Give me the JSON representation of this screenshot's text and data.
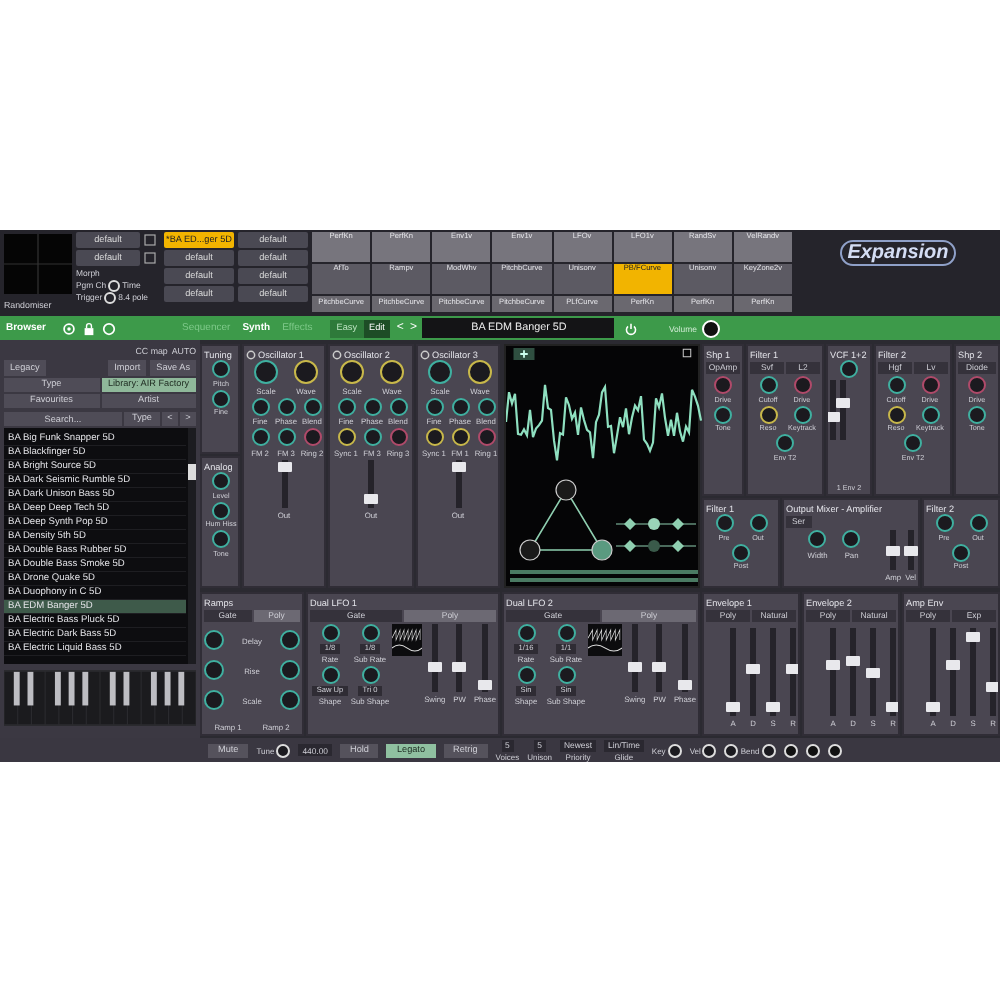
{
  "header": {
    "randomiser": "Randomiser",
    "slot_column": [
      {
        "label": "default"
      },
      {
        "label": "default"
      }
    ],
    "options": [
      {
        "label": "Morph"
      },
      {
        "label": "Pgm Ch",
        "radio": "Time",
        "checked": false
      },
      {
        "label": "Trigger",
        "radio": "8.4 pole",
        "checked": false
      }
    ],
    "patch_slots": [
      {
        "label": "*BA ED...ger 5D",
        "selected": true
      },
      {
        "label": "default",
        "selected": false
      },
      {
        "label": "default",
        "selected": false
      },
      {
        "label": "default",
        "selected": false
      },
      {
        "label": "default",
        "selected": false
      },
      {
        "label": "default",
        "selected": false
      },
      {
        "label": "default",
        "selected": false
      },
      {
        "label": "default",
        "selected": false
      }
    ],
    "mod_matrix": [
      [
        {
          "label": "PerfKn",
          "selected": false
        },
        {
          "label": "PerfKn",
          "selected": false
        },
        {
          "label": "Env1v",
          "selected": false
        },
        {
          "label": "Env1v",
          "selected": false
        },
        {
          "label": "LFOv",
          "selected": false
        },
        {
          "label": "LFO1v",
          "selected": false
        },
        {
          "label": "RandSv",
          "selected": false
        },
        {
          "label": "VelRandv",
          "selected": false
        }
      ],
      [
        {
          "label": "AfTo",
          "selected": false
        },
        {
          "label": "Rampv",
          "selected": false
        },
        {
          "label": "ModWhv",
          "selected": false
        },
        {
          "label": "PitchbCurve",
          "selected": false
        },
        {
          "label": "Unisonv",
          "selected": false
        },
        {
          "label": "PB/FCurve",
          "selected": true
        },
        {
          "label": "Unisonv",
          "selected": false
        },
        {
          "label": "KeyZone2v",
          "selected": false
        }
      ],
      [
        {
          "label": "PitchbeCurve",
          "selected": false
        },
        {
          "label": "PitchbeCurve",
          "selected": false
        },
        {
          "label": "PitchbeCurve",
          "selected": false
        },
        {
          "label": "PitchbeCurve",
          "selected": false
        },
        {
          "label": "PLfCurve",
          "selected": false
        },
        {
          "label": "PerfKn",
          "selected": false
        },
        {
          "label": "PerfKn",
          "selected": false
        },
        {
          "label": "PerfKn",
          "selected": false
        }
      ]
    ],
    "logo": "Expansion"
  },
  "navbar": {
    "title": "Browser",
    "tabs": [
      {
        "label": "Sequencer",
        "selected": false
      },
      {
        "label": "Synth",
        "selected": true
      },
      {
        "label": "Effects",
        "selected": false
      }
    ],
    "modes": [
      {
        "label": "Easy",
        "selected": false
      },
      {
        "label": "Edit",
        "selected": true
      }
    ],
    "prev": "<",
    "next": ">",
    "preset": "BA EDM Banger 5D",
    "volume": "Volume"
  },
  "browser": {
    "cc_map": "CC map",
    "cc_value": "AUTO",
    "legacy": "Legacy",
    "import": "Import",
    "save_as": "Save As",
    "filters": [
      {
        "label": "Type",
        "selected": false
      },
      {
        "label": "Library: AIR Factory",
        "selected": true
      },
      {
        "label": "Favourites",
        "selected": false
      },
      {
        "label": "Artist",
        "selected": false
      }
    ],
    "search": {
      "placeholder": "Search..."
    },
    "sort": "Type",
    "prev": "<",
    "next": ">",
    "presets": [
      {
        "name": "BA Big Funk Snapper 5D",
        "selected": false
      },
      {
        "name": "BA Blackfinger 5D",
        "selected": false
      },
      {
        "name": "BA Bright Source 5D",
        "selected": false
      },
      {
        "name": "BA Dark Seismic Rumble 5D",
        "selected": false
      },
      {
        "name": "BA Dark Unison Bass 5D",
        "selected": false
      },
      {
        "name": "BA Deep Deep Tech 5D",
        "selected": false
      },
      {
        "name": "BA Deep Synth Pop 5D",
        "selected": false
      },
      {
        "name": "BA Density 5th 5D",
        "selected": false
      },
      {
        "name": "BA Double Bass Rubber 5D",
        "selected": false
      },
      {
        "name": "BA Double Bass Smoke 5D",
        "selected": false
      },
      {
        "name": "BA Drone Quake 5D",
        "selected": false
      },
      {
        "name": "BA Duophony in C 5D",
        "selected": false
      },
      {
        "name": "BA EDM Banger 5D",
        "selected": true
      },
      {
        "name": "BA Electric Bass Pluck 5D",
        "selected": false
      },
      {
        "name": "BA Electric Dark Bass 5D",
        "selected": false
      },
      {
        "name": "BA Electric Liquid Bass 5D",
        "selected": false
      }
    ]
  },
  "left_column": [
    {
      "title": "Tuning",
      "kind": "basic",
      "knobs": [
        {
          "label": "Pitch",
          "color": "#3fb0a0"
        },
        {
          "label": "Fine",
          "color": "#3fb0a0"
        }
      ]
    },
    {
      "title": "Analog",
      "kind": "basic",
      "knobs": [
        {
          "label": "Level",
          "color": "#3fb0a0"
        },
        {
          "label": "Hum Hiss",
          "color": "#3fb0a0"
        },
        {
          "label": "Tone",
          "color": "#3fb0a0"
        }
      ]
    }
  ],
  "oscillators": [
    {
      "title": "Oscillator 1",
      "kind": "osc",
      "knobs": [
        {
          "label": "Scale",
          "color": "#3fb0a0"
        },
        {
          "label": "Wave",
          "color": "#c8b84a"
        },
        {
          "label": "Fine",
          "color": "#3fb0a0"
        },
        {
          "label": "Phase",
          "color": "#3fb0a0"
        },
        {
          "label": "Blend",
          "color": "#3fb0a0"
        },
        {
          "label": "FM 2",
          "color": "#3fb0a0"
        },
        {
          "label": "FM 3",
          "color": "#3fb0a0"
        },
        {
          "label": "Ring 2",
          "color": "#b04a6a"
        }
      ],
      "sliders": [
        {
          "label": "Out",
          "level": 0.9
        }
      ]
    },
    {
      "title": "Oscillator 2",
      "kind": "osc",
      "knobs": [
        {
          "label": "Scale",
          "color": "#c8b84a"
        },
        {
          "label": "Wave",
          "color": "#c8b84a"
        },
        {
          "label": "Fine",
          "color": "#3fb0a0"
        },
        {
          "label": "Phase",
          "color": "#3fb0a0"
        },
        {
          "label": "Blend",
          "color": "#3fb0a0"
        },
        {
          "label": "Sync 1",
          "color": "#c8b84a"
        },
        {
          "label": "FM 3",
          "color": "#3fb0a0"
        },
        {
          "label": "Ring 3",
          "color": "#b04a6a"
        }
      ],
      "sliders": [
        {
          "label": "Out",
          "level": 0.1
        }
      ]
    },
    {
      "title": "Oscillator 3",
      "kind": "osc",
      "knobs": [
        {
          "label": "Scale",
          "color": "#3fb0a0"
        },
        {
          "label": "Wave",
          "color": "#c8b84a"
        },
        {
          "label": "Fine",
          "color": "#3fb0a0"
        },
        {
          "label": "Phase",
          "color": "#3fb0a0"
        },
        {
          "label": "Blend",
          "color": "#3fb0a0"
        },
        {
          "label": "Sync 1",
          "color": "#c8b84a"
        },
        {
          "label": "FM 1",
          "color": "#c8b84a"
        },
        {
          "label": "Ring 1",
          "color": "#b04a6a"
        }
      ],
      "sliders": [
        {
          "label": "Out",
          "level": 0.9
        }
      ]
    }
  ],
  "filter_row": [
    {
      "title": "Shp 1",
      "kind": "basic",
      "buttons": [
        {
          "label": "OpAmp",
          "selected": false
        }
      ],
      "knobs": [
        {
          "label": "Drive",
          "color": "#b04a6a"
        },
        {
          "label": "Tone",
          "color": "#3fb0a0"
        }
      ]
    },
    {
      "title": "Filter 1",
      "kind": "basic",
      "buttons": [
        {
          "label": "Svf",
          "selected": false
        },
        {
          "label": "L2",
          "selected": false
        }
      ],
      "knobs": [
        {
          "label": "Cutoff",
          "color": "#3fb0a0"
        },
        {
          "label": "Drive",
          "color": "#b04a6a"
        },
        {
          "label": "Reso",
          "color": "#c8b84a"
        },
        {
          "label": "Keytrack",
          "color": "#3fb0a0"
        },
        {
          "label": "Env T2",
          "color": "#3fb0a0"
        }
      ]
    },
    {
      "title": "VCF 1+2",
      "kind": "basic",
      "knobs": [
        {
          "color": "#3fb0a0"
        }
      ],
      "sliders": [
        {
          "level": 0.35
        },
        {
          "level": 0.65
        }
      ],
      "captions": [
        "1 Env 2"
      ]
    },
    {
      "title": "Filter 2",
      "kind": "basic",
      "buttons": [
        {
          "label": "Hgf",
          "selected": false
        },
        {
          "label": "Lv",
          "selected": false
        }
      ],
      "knobs": [
        {
          "label": "Cutoff",
          "color": "#3fb0a0"
        },
        {
          "label": "Drive",
          "color": "#b04a6a"
        },
        {
          "label": "Reso",
          "color": "#c8b84a"
        },
        {
          "label": "Keytrack",
          "color": "#3fb0a0"
        },
        {
          "label": "Env T2",
          "color": "#3fb0a0"
        }
      ]
    },
    {
      "title": "Shp 2",
      "kind": "basic",
      "buttons": [
        {
          "label": "Diode",
          "selected": false
        }
      ],
      "knobs": [
        {
          "label": "Drive",
          "color": "#b04a6a"
        },
        {
          "label": "Tone",
          "color": "#3fb0a0"
        }
      ]
    }
  ],
  "mixer_row": [
    {
      "title": "Filter 1",
      "kind": "basic",
      "knobs": [
        {
          "label": "Pre",
          "color": "#3fb0a0"
        },
        {
          "label": "Out",
          "color": "#3fb0a0"
        },
        {
          "label": "Post",
          "color": "#3fb0a0"
        }
      ]
    },
    {
      "title": "Output Mixer - Amplifier",
      "kind": "mixer",
      "knobs": [
        {
          "label": "Width",
          "color": "#3fb0a0"
        },
        {
          "label": "Pan",
          "color": "#3fb0a0"
        }
      ],
      "buttons": [
        {
          "label": "Ser",
          "selected": false
        }
      ],
      "sliders": [
        {
          "label": "Amp",
          "level": 0.5
        },
        {
          "label": "Vel",
          "level": 0.5
        }
      ]
    },
    {
      "title": "Filter 2",
      "kind": "basic",
      "knobs": [
        {
          "label": "Pre",
          "color": "#3fb0a0"
        },
        {
          "label": "Out",
          "color": "#3fb0a0"
        },
        {
          "label": "Post",
          "color": "#3fb0a0"
        }
      ]
    }
  ],
  "bottom_row": [
    {
      "title": "Ramps",
      "kind": "ramps",
      "buttons": [
        {
          "label": "Gate",
          "selected": false
        },
        {
          "label": "Poly",
          "selected": true
        }
      ],
      "knobs": [
        {
          "label": "Delay",
          "color": "#3fb0a0"
        },
        {
          "label": "Rise",
          "color": "#3fb0a0"
        },
        {
          "label": "Scale",
          "color": "#3fb0a0"
        }
      ],
      "captions": [
        "Ramp 1",
        "Ramp 2"
      ]
    },
    {
      "title": "Dual LFO 1",
      "kind": "lfo",
      "buttons": [
        {
          "label": "Gate",
          "selected": false
        },
        {
          "label": "Poly",
          "selected": true
        }
      ],
      "knobs": [
        {
          "label": "Rate",
          "value": "1/8",
          "color": "#3fb0a0"
        },
        {
          "label": "Sub Rate",
          "value": "1/8",
          "color": "#3fb0a0"
        },
        {
          "label": "Shape",
          "value": "Saw Up",
          "color": "#3fb0a0"
        },
        {
          "label": "Sub Shape",
          "value": "Tri 0",
          "color": "#3fb0a0"
        }
      ],
      "sliders": [
        {
          "label": "Swing",
          "level": 0.35
        },
        {
          "label": "PW",
          "level": 0.35
        },
        {
          "label": "Phase",
          "level": 0.05
        }
      ]
    },
    {
      "title": "Dual LFO 2",
      "kind": "lfo",
      "buttons": [
        {
          "label": "Gate",
          "selected": false
        },
        {
          "label": "Poly",
          "selected": true
        }
      ],
      "knobs": [
        {
          "label": "Rate",
          "value": "1/16",
          "color": "#3fb0a0"
        },
        {
          "label": "Sub Rate",
          "value": "1/1",
          "color": "#3fb0a0"
        },
        {
          "label": "Shape",
          "value": "Sin",
          "color": "#3fb0a0"
        },
        {
          "label": "Sub Shape",
          "value": "Sin",
          "color": "#3fb0a0"
        }
      ],
      "sliders": [
        {
          "label": "Swing",
          "level": 0.35
        },
        {
          "label": "PW",
          "level": 0.35
        },
        {
          "label": "Phase",
          "level": 0.05
        }
      ]
    },
    {
      "title": "Envelope 1",
      "kind": "envelope",
      "buttons": [
        {
          "label": "Poly",
          "selected": false
        },
        {
          "label": "Natural",
          "selected": false
        }
      ],
      "sliders": [
        {
          "label": "A",
          "level": 0.05
        },
        {
          "label": "D",
          "level": 0.55
        },
        {
          "label": "S",
          "level": 0.05
        },
        {
          "label": "R",
          "level": 0.55
        }
      ]
    },
    {
      "title": "Envelope 2",
      "kind": "envelope",
      "buttons": [
        {
          "label": "Poly",
          "selected": false
        },
        {
          "label": "Natural",
          "selected": false
        }
      ],
      "sliders": [
        {
          "label": "A",
          "level": 0.6
        },
        {
          "label": "D",
          "level": 0.65
        },
        {
          "label": "S",
          "level": 0.5
        },
        {
          "label": "R",
          "level": 0.05
        }
      ]
    },
    {
      "title": "Amp Env",
      "kind": "envelope",
      "buttons": [
        {
          "label": "Poly",
          "selected": false
        },
        {
          "label": "Exp",
          "selected": false
        }
      ],
      "sliders": [
        {
          "label": "A",
          "level": 0.05
        },
        {
          "label": "D",
          "level": 0.6
        },
        {
          "label": "S",
          "level": 0.95
        },
        {
          "label": "R",
          "level": 0.3
        }
      ]
    }
  ],
  "bottom_bar": [
    {
      "kind": "button",
      "label": "Mute",
      "selected": false
    },
    {
      "kind": "knob",
      "label": "Tune"
    },
    {
      "kind": "value",
      "label": "440.00"
    },
    {
      "kind": "button",
      "label": "Hold",
      "selected": false
    },
    {
      "kind": "button",
      "label": "Legato",
      "selected": true
    },
    {
      "kind": "button",
      "label": "Retrig",
      "selected": false
    },
    {
      "kind": "stack",
      "value": "5",
      "label": "Voices"
    },
    {
      "kind": "stack",
      "value": "5",
      "label": "Unison"
    },
    {
      "kind": "stack",
      "value": "Newest",
      "label": "Priority"
    },
    {
      "kind": "stack",
      "value": "Lin/Time",
      "label": "Glide"
    },
    {
      "kind": "knob",
      "label": "Key"
    },
    {
      "kind": "knob",
      "label": "Vel"
    },
    {
      "kind": "bend",
      "label": "Bend"
    },
    {
      "kind": "jack"
    },
    {
      "kind": "jack"
    },
    {
      "kind": "jack"
    }
  ]
}
